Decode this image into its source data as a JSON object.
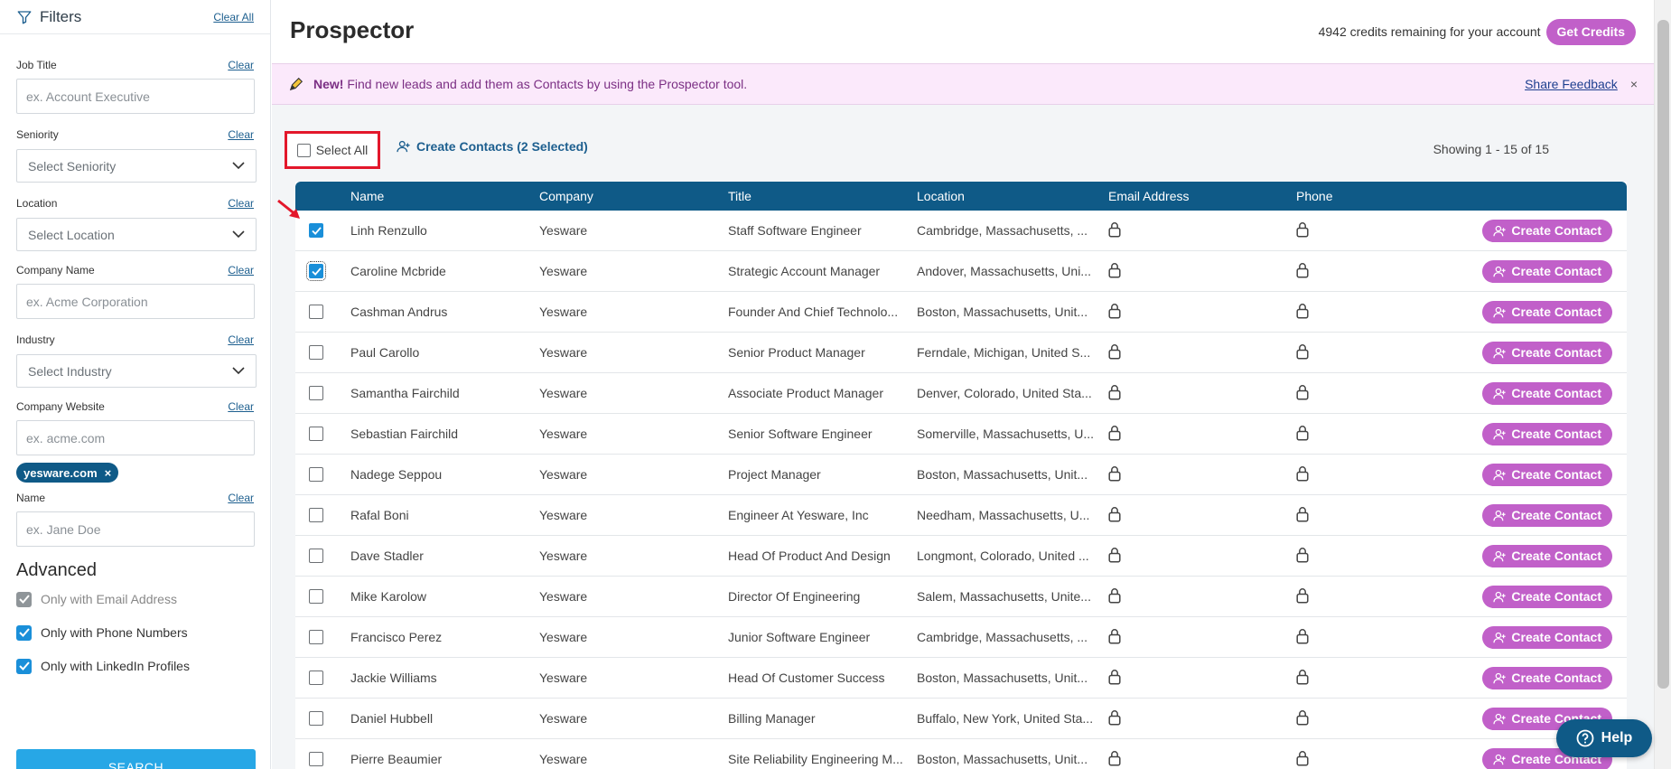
{
  "sidebar": {
    "title": "Filters",
    "clear_all": "Clear All",
    "fields": [
      {
        "label": "Job Title",
        "clear": "Clear",
        "type": "input",
        "placeholder": "ex. Account Executive"
      },
      {
        "label": "Seniority",
        "clear": "Clear",
        "type": "select",
        "value": "Select Seniority"
      },
      {
        "label": "Location",
        "clear": "Clear",
        "type": "select",
        "value": "Select Location"
      },
      {
        "label": "Company Name",
        "clear": "Clear",
        "type": "input",
        "placeholder": "ex. Acme Corporation"
      },
      {
        "label": "Industry",
        "clear": "Clear",
        "type": "select",
        "value": "Select Industry"
      },
      {
        "label": "Company Website",
        "clear": "Clear",
        "type": "input",
        "placeholder": "ex. acme.com"
      },
      {
        "label": "Name",
        "clear": "Clear",
        "type": "input",
        "placeholder": "ex. Jane Doe"
      }
    ],
    "website_chip": "yesware.com",
    "chip_remove": "×",
    "advanced_title": "Advanced",
    "advanced": [
      {
        "label": "Only with Email Address",
        "state": "disabled-checked"
      },
      {
        "label": "Only with Phone Numbers",
        "state": "checked"
      },
      {
        "label": "Only with LinkedIn Profiles",
        "state": "checked"
      }
    ],
    "search_label": "SEARCH"
  },
  "header": {
    "title": "Prospector",
    "credits_text": "4942 credits remaining for your account",
    "get_credits": "Get Credits"
  },
  "banner": {
    "new_label": "New!",
    "text": "Find new leads and add them as Contacts by using the Prospector tool.",
    "feedback": "Share Feedback",
    "close": "×"
  },
  "toolbar": {
    "select_all": "Select All",
    "create_selected": "Create Contacts (2 Selected)",
    "showing": "Showing 1 - 15 of 15"
  },
  "table": {
    "columns": [
      "Name",
      "Company",
      "Title",
      "Location",
      "Email Address",
      "Phone"
    ],
    "action_label": "Create Contact",
    "rows": [
      {
        "name": "Linh Renzullo",
        "company": "Yesware",
        "title": "Staff Software Engineer",
        "location": "Cambridge, Massachusetts, ...",
        "checked": true
      },
      {
        "name": "Caroline Mcbride",
        "company": "Yesware",
        "title": "Strategic Account Manager",
        "location": "Andover, Massachusetts, Uni...",
        "checked": true
      },
      {
        "name": "Cashman Andrus",
        "company": "Yesware",
        "title": "Founder And Chief Technolo...",
        "location": "Boston, Massachusetts, Unit...",
        "checked": false
      },
      {
        "name": "Paul Carollo",
        "company": "Yesware",
        "title": "Senior Product Manager",
        "location": "Ferndale, Michigan, United S...",
        "checked": false
      },
      {
        "name": "Samantha Fairchild",
        "company": "Yesware",
        "title": "Associate Product Manager",
        "location": "Denver, Colorado, United Sta...",
        "checked": false
      },
      {
        "name": "Sebastian Fairchild",
        "company": "Yesware",
        "title": "Senior Software Engineer",
        "location": "Somerville, Massachusetts, U...",
        "checked": false
      },
      {
        "name": "Nadege Seppou",
        "company": "Yesware",
        "title": "Project Manager",
        "location": "Boston, Massachusetts, Unit...",
        "checked": false
      },
      {
        "name": "Rafal Boni",
        "company": "Yesware",
        "title": "Engineer At Yesware, Inc",
        "location": "Needham, Massachusetts, U...",
        "checked": false
      },
      {
        "name": "Dave Stadler",
        "company": "Yesware",
        "title": "Head Of Product And Design",
        "location": "Longmont, Colorado, United ...",
        "checked": false
      },
      {
        "name": "Mike Karolow",
        "company": "Yesware",
        "title": "Director Of Engineering",
        "location": "Salem, Massachusetts, Unite...",
        "checked": false
      },
      {
        "name": "Francisco Perez",
        "company": "Yesware",
        "title": "Junior Software Engineer",
        "location": "Cambridge, Massachusetts, ...",
        "checked": false
      },
      {
        "name": "Jackie Williams",
        "company": "Yesware",
        "title": "Head Of Customer Success",
        "location": "Boston, Massachusetts, Unit...",
        "checked": false
      },
      {
        "name": "Daniel Hubbell",
        "company": "Yesware",
        "title": "Billing Manager",
        "location": "Buffalo, New York, United Sta...",
        "checked": false
      },
      {
        "name": "Pierre Beaumier",
        "company": "Yesware",
        "title": "Site Reliability Engineering M...",
        "location": "Boston, Massachusetts, Unit...",
        "checked": false
      }
    ]
  },
  "help_label": "Help",
  "colors": {
    "primary_blue": "#0f5a87",
    "accent_purple": "#c160c9",
    "checkbox_blue": "#1a8fd9",
    "highlight_red": "#e3172b"
  }
}
